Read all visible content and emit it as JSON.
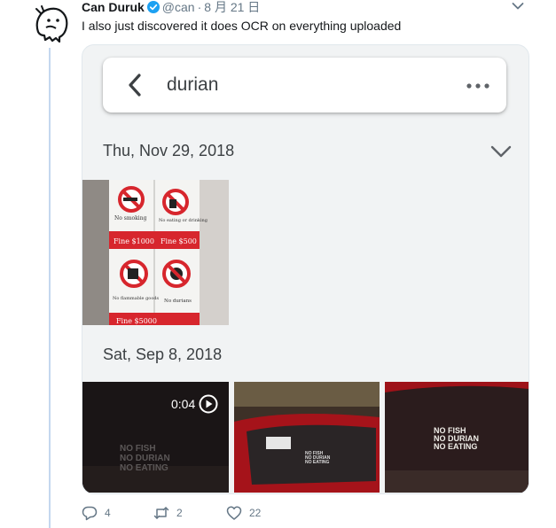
{
  "tweet": {
    "author_name": "Can Duruk",
    "handle": "@can",
    "separator": "·",
    "date": "8 月 21 日",
    "text": "I also just discovered it does OCR on everything uploaded"
  },
  "media": {
    "search_bar": {
      "query": "durian"
    },
    "groups": [
      {
        "date_label": "Thu, Nov 29, 2018"
      },
      {
        "date_label": "Sat, Sep 8, 2018"
      }
    ],
    "sign_photo": {
      "captions": [
        "No smoking",
        "No eating or drinking",
        "No flammable goods",
        "No durians"
      ],
      "fines": [
        "Fine $1000",
        "Fine $500",
        "Fine $5000"
      ]
    },
    "video": {
      "duration": "0:04"
    },
    "car_sticker_text": [
      "NO FISH",
      "NO DURIAN",
      "NO EATING"
    ]
  },
  "actions": {
    "reply_count": "4",
    "retweet_count": "2",
    "like_count": "22"
  },
  "colors": {
    "thread_line": "#c4d7ef",
    "verified_blue": "#1da1f2",
    "sign_red": "#d7262d",
    "muted_text": "#657786"
  }
}
